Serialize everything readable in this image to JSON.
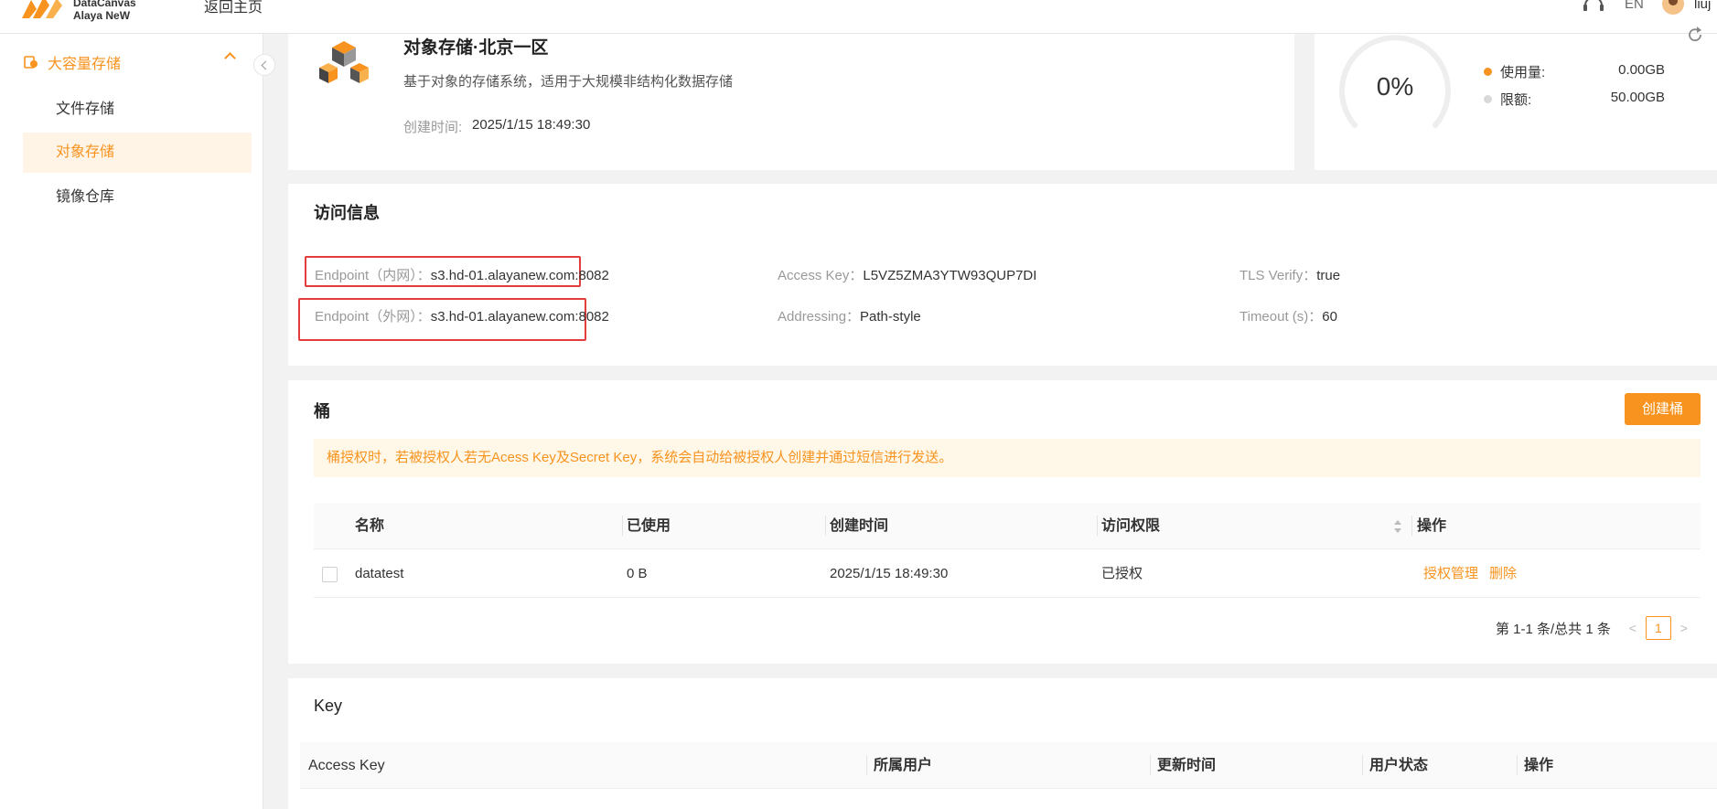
{
  "header": {
    "logo_text_line1": "DataCanvas",
    "logo_text_line2": "Alaya NeW",
    "back_home": "返回主页",
    "lang": "EN",
    "username": "liuj"
  },
  "sidebar": {
    "group_label": "大容量存储",
    "items": [
      {
        "label": "文件存储"
      },
      {
        "label": "对象存储"
      },
      {
        "label": "镜像仓库"
      }
    ]
  },
  "storage": {
    "title": "对象存储·北京一区",
    "description": "基于对象的存储系统，适用于大规模非结构化数据存储",
    "created_label": "创建时间:",
    "created_value": "2025/1/15 18:49:30"
  },
  "usage": {
    "percent_text": "0%",
    "percent_value": 0,
    "used_label": "使用量:",
    "used_value": "0.00GB",
    "limit_label": "限额:",
    "limit_value": "50.00GB",
    "used_color": "#f7931e",
    "limit_color": "#d9d9d9"
  },
  "access": {
    "title": "访问信息",
    "endpoint_internal_label": "Endpoint（内网）：",
    "endpoint_internal_value": "s3.hd-01.alayanew.com:8082",
    "endpoint_external_label": "Endpoint（外网）：",
    "endpoint_external_value": "s3.hd-01.alayanew.com:8082",
    "access_key_label": "Access Key：",
    "access_key_value": "L5VZ5ZMA3YTW93QUP7DI",
    "addressing_label": "Addressing：",
    "addressing_value": "Path-style",
    "tls_label": "TLS Verify：",
    "tls_value": "true",
    "timeout_label": "Timeout (s)：",
    "timeout_value": "60"
  },
  "bucket": {
    "title": "桶",
    "create_button": "创建桶",
    "notice": "桶授权时，若被授权人若无Acess Key及Secret Key，系统会自动给被授权人创建并通过短信进行发送。",
    "columns": [
      "名称",
      "已使用",
      "创建时间",
      "访问权限",
      "操作"
    ],
    "rows": [
      {
        "name": "datatest",
        "used": "0 B",
        "created": "2025/1/15 18:49:30",
        "permission": "已授权",
        "action_manage": "授权管理",
        "action_delete": "删除"
      }
    ],
    "pagination_text": "第 1-1 条/总共 1 条",
    "current_page": "1"
  },
  "key": {
    "title": "Key",
    "columns": [
      "Access Key",
      "所属用户",
      "更新时间",
      "用户状态",
      "操作"
    ]
  }
}
